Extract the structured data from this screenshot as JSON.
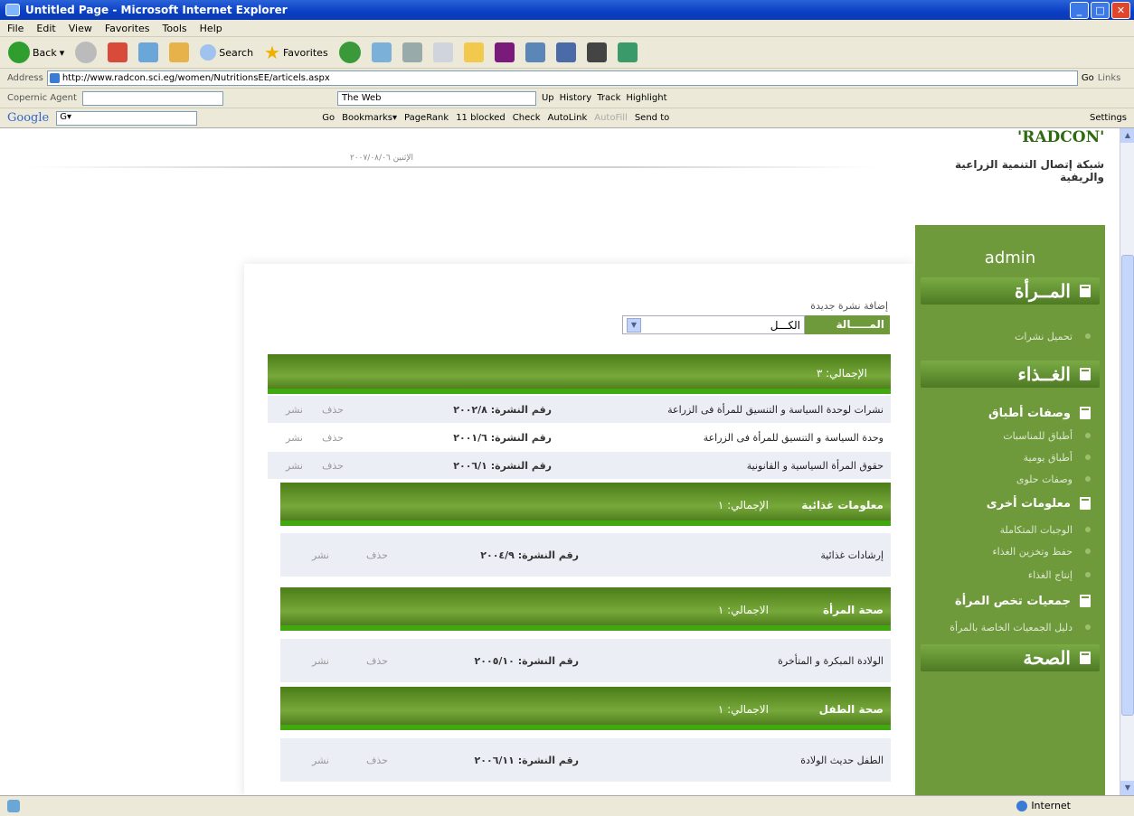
{
  "window": {
    "title": "Untitled Page - Microsoft Internet Explorer",
    "minimize": "_",
    "maximize": "□",
    "close": "✕"
  },
  "menu": [
    "File",
    "Edit",
    "View",
    "Favorites",
    "Tools",
    "Help"
  ],
  "toolbar": {
    "back": "Back",
    "search": "Search",
    "favorites": "Favorites"
  },
  "address": {
    "label": "Address",
    "url": "http://www.radcon.sci.eg/women/NutritionsEE/articels.aspx",
    "go": "Go",
    "links": "Links"
  },
  "agent": {
    "label": "Copernic Agent",
    "the_web": "The Web",
    "up": "Up",
    "history": "History",
    "track": "Track",
    "highlight": "Highlight"
  },
  "google": {
    "logo": "Google",
    "box": "G▾",
    "go": "Go",
    "bookmarks": "Bookmarks▾",
    "pagerank": "PageRank",
    "blocked": "11 blocked",
    "check": "Check",
    "autolink": "AutoLink",
    "autofill": "AutoFill",
    "sendto": "Send to",
    "settings": "Settings"
  },
  "status": {
    "zone": "Internet"
  },
  "site": {
    "logo": "'RADCON'",
    "subtitle": "شبكة إتصال التنمية الزراعية والريفية",
    "date": "الإثنين ٢٠٠٧/٠٨/٠٦"
  },
  "sidebar": {
    "admin": "admin",
    "items": [
      {
        "label": "المــرأة",
        "kind": "big"
      },
      {
        "label": "تحميل نشرات",
        "kind": "sub"
      },
      {
        "label": "الغــذاء",
        "kind": "big"
      },
      {
        "label": "وصفات أطباق",
        "kind": "mid"
      },
      {
        "label": "أطباق للمناسبات",
        "kind": "sub"
      },
      {
        "label": "أطباق يومية",
        "kind": "sub"
      },
      {
        "label": "وصفات حلوى",
        "kind": "sub"
      },
      {
        "label": "معلومات أخرى",
        "kind": "mid"
      },
      {
        "label": "الوجبات المتكاملة",
        "kind": "sub"
      },
      {
        "label": "حفظ وتخزين الغذاء",
        "kind": "sub"
      },
      {
        "label": "إنتاج الغذاء",
        "kind": "sub"
      },
      {
        "label": "جمعيات تخص المرأة",
        "kind": "mid"
      },
      {
        "label": "دليل الجمعيات الخاصة بالمرأة",
        "kind": "sub"
      },
      {
        "label": "الصحة",
        "kind": "big"
      }
    ]
  },
  "main": {
    "add_new": "إضافة نشرة جديدة",
    "filter_label": "المـــــالة",
    "filter_value": "الكـــل",
    "total_label": "الإجمالي: ٣",
    "del": "حذف",
    "pub": "نشر",
    "groups": [
      {
        "header": null,
        "rows": [
          {
            "title": "نشرات لوحدة السياسة و التنسيق للمرأة فى الزراعة",
            "num": "رقم النشرة: ٢٠٠٢/٨"
          },
          {
            "title": "وحدة السياسة و التنسيق للمرأة فى الزراعة",
            "num": "رقم النشرة: ٢٠٠١/٦"
          },
          {
            "title": "حقوق المرأة السياسية و القانونية",
            "num": "رقم النشرة: ٢٠٠٦/١"
          }
        ]
      },
      {
        "header": {
          "name": "معلومات غذائية",
          "total": "الإجمالي: ١"
        },
        "rows": [
          {
            "title": "إرشادات غذائية",
            "num": "رقم النشرة: ٢٠٠٤/٩"
          }
        ]
      },
      {
        "header": {
          "name": "صحة المرأة",
          "total": "الاجمالي: ١"
        },
        "rows": [
          {
            "title": "الولادة المبكرة و المتأخرة",
            "num": "رقم النشرة: ٢٠٠٥/١٠"
          }
        ]
      },
      {
        "header": {
          "name": "صحة الطفل",
          "total": "الاجمالي: ١"
        },
        "rows": [
          {
            "title": "الطفل حديث الولادة",
            "num": "رقم النشرة: ٢٠٠٦/١١"
          }
        ]
      }
    ]
  }
}
